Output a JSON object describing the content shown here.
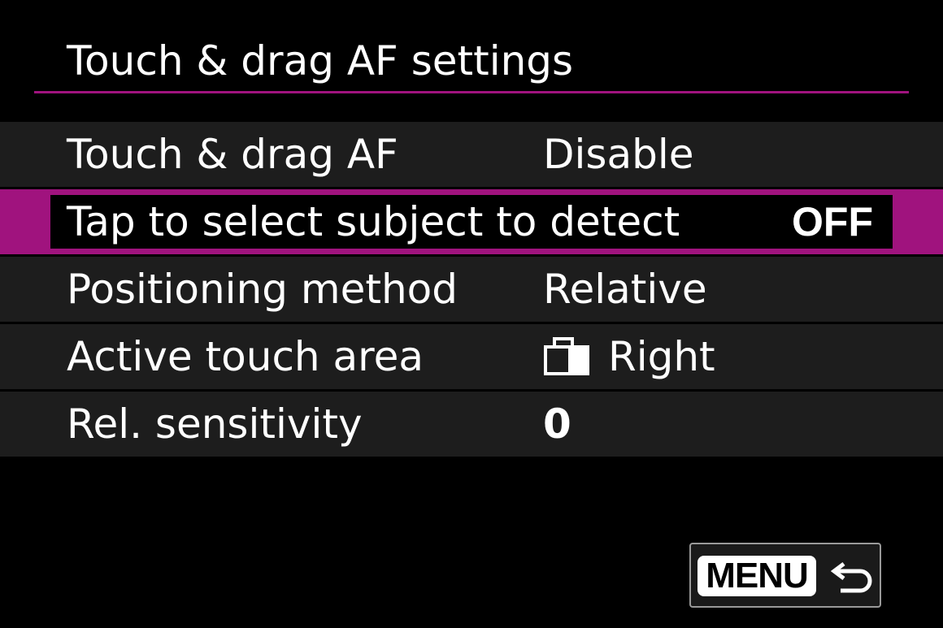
{
  "screen": {
    "title": "Touch & drag AF settings"
  },
  "menu": {
    "items": [
      {
        "label": "Touch & drag AF",
        "value": "Disable",
        "selected": false
      },
      {
        "label": "Tap to select subject to detect",
        "value": "OFF",
        "selected": true
      },
      {
        "label": "Positioning method",
        "value": "Relative",
        "selected": false
      },
      {
        "label": "Active touch area",
        "value": "Right",
        "icon": "camera-right-area-icon",
        "selected": false
      },
      {
        "label": "Rel. sensitivity",
        "value": "0",
        "selected": false
      }
    ]
  },
  "footer": {
    "menu_label": "MENU",
    "return_icon": "return-arrow-icon"
  },
  "colors": {
    "background": "#000000",
    "row_background": "#1d1d1d",
    "accent": "#a0137e",
    "text": "#ffffff"
  }
}
